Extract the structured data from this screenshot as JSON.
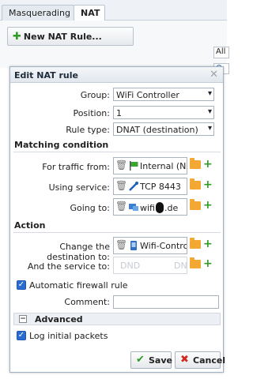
{
  "tabs": [
    {
      "label": "Masquerading"
    },
    {
      "label": "NAT"
    }
  ],
  "toolbar": {
    "new_rule_label": "New NAT Rule...",
    "filter_value": "All"
  },
  "dialog": {
    "title": "Edit NAT rule",
    "group_label": "Group:",
    "group_value": "WiFi Controller",
    "position_label": "Position:",
    "position_value": "1",
    "ruletype_label": "Rule type:",
    "ruletype_value": "DNAT (destination)",
    "matching_heading": "Matching condition",
    "traffic_from_label": "For traffic from:",
    "traffic_from_value": "Internal (Netw",
    "service_label": "Using service:",
    "service_value": "TCP 8443",
    "going_to_label": "Going to:",
    "going_to_value_pre": "wifi",
    "going_to_value_post": ".de",
    "action_heading": "Action",
    "change_dest_label": "Change the destination to:",
    "change_dest_value": "Wifi-Controlle",
    "and_service_label": "And the service to:",
    "and_service_placeholder_left": "DND",
    "and_service_placeholder_right": "DN",
    "auto_fw_label": "Automatic firewall rule",
    "auto_fw_checked": true,
    "comment_label": "Comment:",
    "comment_value": "",
    "advanced_heading": "Advanced",
    "log_label": "Log initial packets",
    "log_checked": true,
    "save_label": "Save",
    "cancel_label": "Cancel"
  },
  "colors": {
    "accent": "#2b6cd3",
    "add_green": "#2f9a24",
    "folder_orange": "#f2a833",
    "cancel_red": "#d0281d"
  }
}
